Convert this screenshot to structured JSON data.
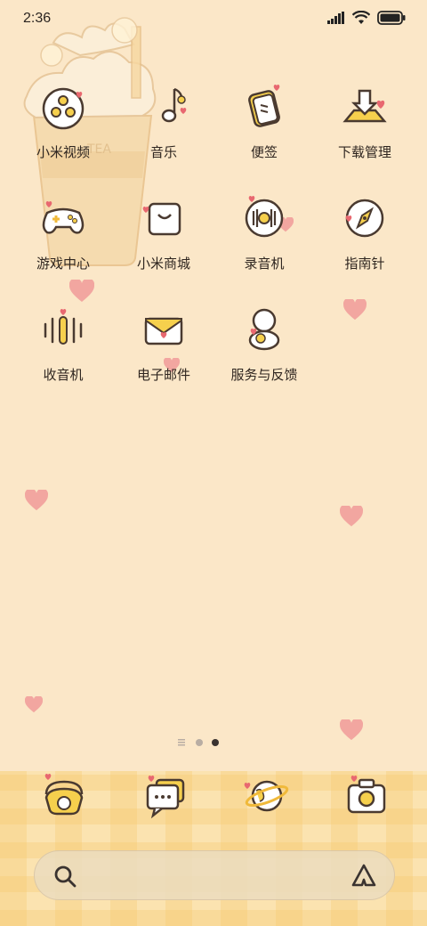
{
  "status_bar": {
    "time": "2:36",
    "icons": [
      "signal-icon",
      "wifi-icon",
      "battery-icon"
    ]
  },
  "wallpaper": {
    "cup_text": "TEA",
    "colors": {
      "background": "#fbe7c8",
      "heart": "#f2a3a0",
      "cup": "#f3d6a6"
    }
  },
  "apps": [
    {
      "label": "小米视频",
      "icon": "video-icon"
    },
    {
      "label": "音乐",
      "icon": "music-icon"
    },
    {
      "label": "便签",
      "icon": "notes-icon"
    },
    {
      "label": "下载管理",
      "icon": "download-icon"
    },
    {
      "label": "游戏中心",
      "icon": "gamepad-icon"
    },
    {
      "label": "小米商城",
      "icon": "shopping-bag-icon"
    },
    {
      "label": "录音机",
      "icon": "recorder-icon"
    },
    {
      "label": "指南针",
      "icon": "compass-icon"
    },
    {
      "label": "收音机",
      "icon": "radio-icon"
    },
    {
      "label": "电子邮件",
      "icon": "email-icon"
    },
    {
      "label": "服务与反馈",
      "icon": "support-icon"
    }
  ],
  "page_indicator": {
    "pages": 3,
    "current": 2
  },
  "dock": {
    "items": [
      {
        "name": "phone",
        "icon": "phone-icon"
      },
      {
        "name": "messages",
        "icon": "messages-icon"
      },
      {
        "name": "browser",
        "icon": "planet-icon"
      },
      {
        "name": "camera",
        "icon": "camera-icon"
      }
    ]
  },
  "search": {
    "icons": [
      "search-icon",
      "assistant-icon"
    ]
  }
}
